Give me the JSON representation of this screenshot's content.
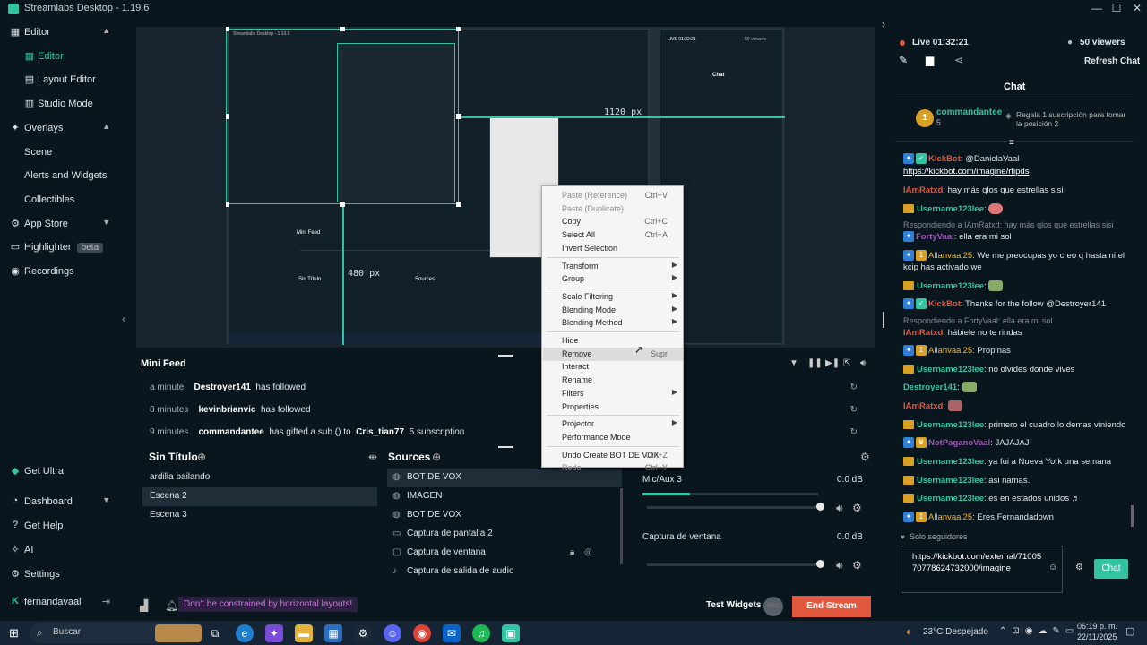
{
  "window": {
    "title": "Streamlabs Desktop - 1.19.6"
  },
  "sidebar": {
    "sections": [
      {
        "label": "Editor",
        "icon": "editor-icon",
        "items": [
          {
            "label": "Editor",
            "icon": "grid-icon"
          },
          {
            "label": "Layout Editor",
            "icon": "layout-icon"
          },
          {
            "label": "Studio Mode",
            "icon": "studio-icon"
          }
        ]
      },
      {
        "label": "Overlays",
        "icon": "overlays-icon",
        "items": [
          {
            "label": "Scene"
          },
          {
            "label": "Alerts and Widgets"
          },
          {
            "label": "Collectibles"
          }
        ]
      }
    ],
    "app_store": "App Store",
    "highlighter": "Highlighter",
    "highlighter_badge": "beta",
    "recordings": "Recordings",
    "bottom": {
      "get_ultra": "Get Ultra",
      "dashboard": "Dashboard",
      "get_help": "Get Help",
      "ai": "AI",
      "settings": "Settings",
      "user": "fernandavaal"
    }
  },
  "preview": {
    "width_label": "1120 px",
    "height_label": "480 px",
    "mock_title": "Streamlabs Desktop - 1.19.6",
    "mock_minifeed": "Mini Feed",
    "mock_scenes_title": "Sin Título",
    "mock_sources_title": "Sources",
    "mock_chat_title": "Chat",
    "mock_live": "LIVE 01:32:21",
    "mock_viewers": "50 viewers"
  },
  "minifeed": {
    "title": "Mini Feed",
    "rows": [
      {
        "time": "a minute",
        "user": "Destroyer141",
        "action": "has followed",
        "extra": ""
      },
      {
        "time": "8 minutes",
        "user": "kevinbrianvic",
        "action": "has followed",
        "extra": ""
      },
      {
        "time": "9 minutes",
        "user": "commandantee",
        "action": "has gifted a sub () to",
        "extra": "Cris_tian77",
        "tail": "5 subscription"
      }
    ]
  },
  "scenes": {
    "title": "Sin Título",
    "items": [
      "ardilla bailando",
      "Escena 2",
      "Escena 3"
    ],
    "selected": 1
  },
  "sources": {
    "title": "Sources",
    "items": [
      {
        "label": "BOT DE VOX",
        "icon": "globe-icon"
      },
      {
        "label": "IMAGEN",
        "icon": "globe-icon"
      },
      {
        "label": "BOT DE VOX",
        "icon": "globe-icon"
      },
      {
        "label": "Captura de pantalla 2",
        "icon": "monitor-icon"
      },
      {
        "label": "Captura de ventana",
        "icon": "window-icon"
      },
      {
        "label": "Captura de salida de audio",
        "icon": "speaker-icon"
      }
    ]
  },
  "mixer": {
    "channels": [
      {
        "name": "Mic/Aux 3",
        "db": "0.0 dB",
        "level": 0.1
      },
      {
        "name": "Captura de ventana",
        "db": "0.0 dB",
        "level": 0.0
      }
    ]
  },
  "footer": {
    "tip": "Don't be constrained by horizontal layouts!",
    "test_widgets": "Test Widgets",
    "end_stream": "End Stream",
    "rec_label": "REC"
  },
  "stream": {
    "live": "Live 01:32:21",
    "viewers": "50 viewers",
    "refresh_chat": "Refresh Chat"
  },
  "chat": {
    "title": "Chat",
    "top_user": "commandantee",
    "top_count": "5",
    "top_rank": "1",
    "gift_prompt": "Regala 1 suscripción para tomar la posición 2",
    "messages": [
      {
        "user": "KickBot",
        "text": "@DanielaVaal",
        "kind": "bot"
      },
      {
        "user": "",
        "text": "https://kickbot.com/imagine/rfipds",
        "kind": "link"
      },
      {
        "user": "IAmRatxd",
        "text": "hay más qlos que estrellas sisi",
        "kind": "red"
      },
      {
        "user": "Username123lee",
        "text": "",
        "kind": "sub"
      },
      {
        "user": "",
        "text": "Respondiendo a IAmRatxd: hay más qlos que estrellas sisi",
        "kind": "reply"
      },
      {
        "user": "FortyVaal",
        "text": "ella era mi sol",
        "kind": "purple"
      },
      {
        "user": "Allanvaal25",
        "text": "We me preocupas yo creo q hasta ni el kcip has activado we",
        "kind": "gold"
      },
      {
        "user": "Username123lee",
        "text": "",
        "kind": "sub"
      },
      {
        "user": "KickBot",
        "text": "Thanks for the follow @Destroyer141",
        "kind": "bot"
      },
      {
        "user": "",
        "text": "Respondiendo a FortyVaal: ella era mi sol",
        "kind": "reply"
      },
      {
        "user": "IAmRatxd",
        "text": "hábiele no te rindas",
        "kind": "red"
      },
      {
        "user": "Allanvaal25",
        "text": "Propinas",
        "kind": "gold"
      },
      {
        "user": "Username123lee",
        "text": "no olvides donde vives",
        "kind": "sub"
      },
      {
        "user": "Destroyer141",
        "text": "",
        "kind": "plain"
      },
      {
        "user": "IAmRatxd",
        "text": "",
        "kind": "red"
      },
      {
        "user": "Username123lee",
        "text": "primero el cuadro lo demas viniendo",
        "kind": "sub"
      },
      {
        "user": "NotPaganoVaal",
        "text": "JAJAJAJ",
        "kind": "purple"
      },
      {
        "user": "Username123lee",
        "text": "ya fui a Nueva York una semana",
        "kind": "sub"
      },
      {
        "user": "Username123lee",
        "text": "asi namas.",
        "kind": "sub"
      },
      {
        "user": "Username123lee",
        "text": "es en estados unidos ♬",
        "kind": "sub"
      },
      {
        "user": "Allanvaal25",
        "text": "Eres Fernandadown",
        "kind": "gold"
      }
    ],
    "followers_only": "Solo seguidores",
    "input_value": "https://kickbot.com/external/7100570778624732000/imagine",
    "send": "Chat"
  },
  "context_menu": {
    "items": [
      {
        "label": "Paste (Reference)",
        "shortcut": "Ctrl+V",
        "disabled": true
      },
      {
        "label": "Paste (Duplicate)",
        "shortcut": "",
        "disabled": true
      },
      {
        "label": "Copy",
        "shortcut": "Ctrl+C"
      },
      {
        "label": "Select All",
        "shortcut": "Ctrl+A"
      },
      {
        "label": "Invert Selection",
        "shortcut": ""
      },
      {
        "label": "Transform",
        "submenu": true
      },
      {
        "label": "Group",
        "submenu": true
      },
      {
        "label": "Scale Filtering",
        "submenu": true
      },
      {
        "label": "Blending Mode",
        "submenu": true
      },
      {
        "label": "Blending Method",
        "submenu": true
      },
      {
        "label": "Hide"
      },
      {
        "label": "Remove",
        "shortcut": "Supr",
        "highlight": true
      },
      {
        "label": "Interact"
      },
      {
        "label": "Rename"
      },
      {
        "label": "Filters",
        "submenu": true
      },
      {
        "label": "Properties"
      },
      {
        "label": "Projector",
        "submenu": true
      },
      {
        "label": "Performance Mode"
      },
      {
        "label": "Undo Create BOT DE VOX",
        "shortcut": "Ctrl+Z"
      },
      {
        "label": "Redo",
        "shortcut": "Ctrl+Y",
        "disabled": true
      }
    ]
  },
  "taskbar": {
    "search": "Buscar",
    "weather": "23°C Despejado",
    "time": "06:19 p. m.",
    "date": "22/11/2025"
  },
  "colors": {
    "accent": "#31c3a2",
    "bg": "#09161d",
    "end_stream": "#e2583e",
    "tip": "#c879d6"
  }
}
